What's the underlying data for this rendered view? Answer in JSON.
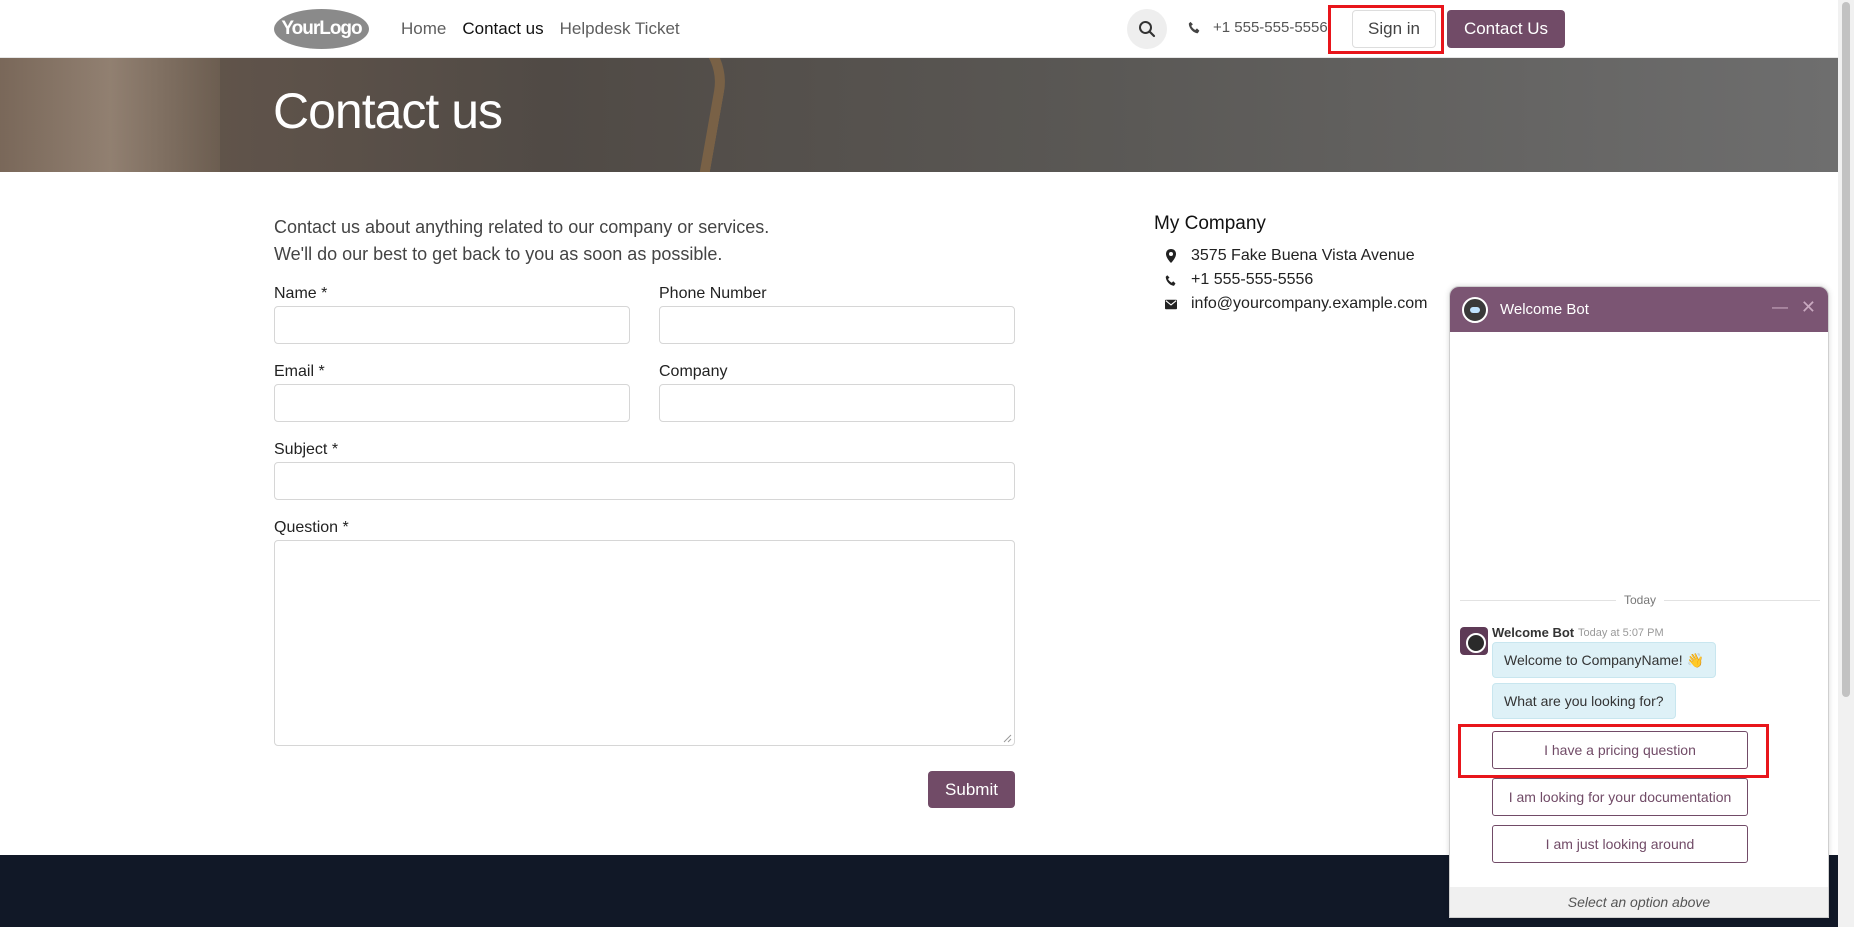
{
  "header": {
    "logo_text": "YourLogo",
    "nav": [
      {
        "label": "Home"
      },
      {
        "label": "Contact us"
      },
      {
        "label": "Helpdesk Ticket"
      }
    ],
    "phone": "+1 555-555-5556",
    "sign_in_label": "Sign in",
    "contact_label": "Contact Us"
  },
  "hero": {
    "title": "Contact us"
  },
  "form": {
    "intro_line1": "Contact us about anything related to our company or services.",
    "intro_line2": "We'll do our best to get back to you as soon as possible.",
    "name_label": "Name *",
    "phone_label": "Phone Number",
    "email_label": "Email *",
    "company_label": "Company",
    "subject_label": "Subject *",
    "question_label": "Question *",
    "submit_label": "Submit"
  },
  "company": {
    "title": "My Company",
    "address": "3575 Fake Buena Vista Avenue",
    "phone": "+1 555-555-5556",
    "email": "info@yourcompany.example.com"
  },
  "chat": {
    "title": "Welcome Bot",
    "divider": "Today",
    "author": "Welcome Bot",
    "time": "Today at 5:07 PM",
    "msg1": "Welcome to CompanyName! 👋",
    "msg2": "What are you looking for?",
    "options": [
      {
        "label": "I have a pricing question"
      },
      {
        "label": "I am looking for your documentation"
      },
      {
        "label": "I am just looking around"
      }
    ],
    "footer": "Select an option above"
  },
  "colors": {
    "brand": "#714b67",
    "highlight": "#e8151b",
    "footer_bg": "#111827"
  }
}
